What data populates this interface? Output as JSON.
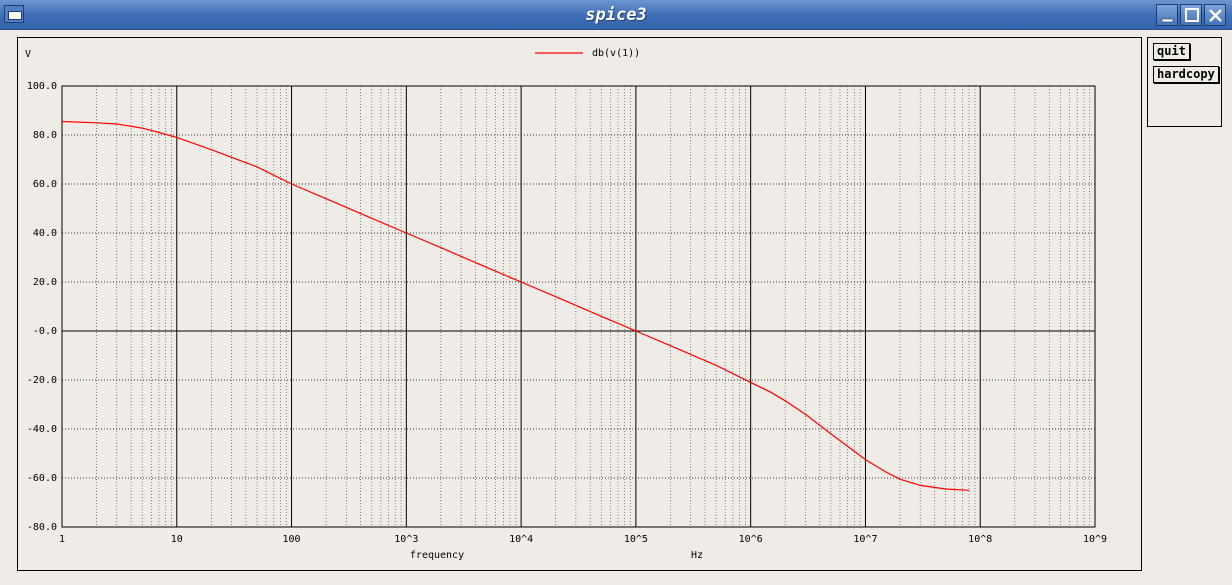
{
  "window": {
    "title": "spice3"
  },
  "side_panel": {
    "quit_label": "quit",
    "hardcopy_label": "hardcopy"
  },
  "colors": {
    "trace": "#ff0000",
    "title_bar": "#3e6db5",
    "background": "#efebe7"
  },
  "chart_data": {
    "type": "line",
    "xscale": "log",
    "xlabel": "frequency",
    "xunit": "Hz",
    "ylabel": "V",
    "xlim": [
      1,
      1000000000
    ],
    "ylim": [
      -80,
      100
    ],
    "x_tick_labels": [
      "1",
      "10",
      "100",
      "10^3",
      "10^4",
      "10^5",
      "10^6",
      "10^7",
      "10^8",
      "10^9"
    ],
    "y_tick_labels": [
      "100.0",
      "80.0",
      "60.0",
      "40.0",
      "20.0",
      "-0.0",
      "-20.0",
      "-40.0",
      "-60.0",
      "-80.0"
    ],
    "grid": true,
    "legend_position": "top-center",
    "series": [
      {
        "name": "db(v(1))",
        "x": [
          1,
          2,
          3,
          5,
          7,
          10,
          20,
          50,
          100,
          200,
          500,
          1000,
          2000,
          5000,
          10000,
          20000,
          50000,
          100000,
          200000,
          500000,
          1000000,
          1500000,
          2000000,
          3000000,
          5000000,
          10000000,
          15000000,
          20000000,
          30000000,
          50000000,
          80000000
        ],
        "values": [
          85.5,
          85,
          84.5,
          82.8,
          81,
          79,
          74,
          67,
          60,
          54,
          46,
          40,
          34,
          26,
          20,
          14,
          6,
          0,
          -6,
          -14,
          -21,
          -25,
          -28.5,
          -34,
          -42,
          -52.5,
          -57.5,
          -60.5,
          -63,
          -64.5,
          -65
        ]
      }
    ]
  }
}
